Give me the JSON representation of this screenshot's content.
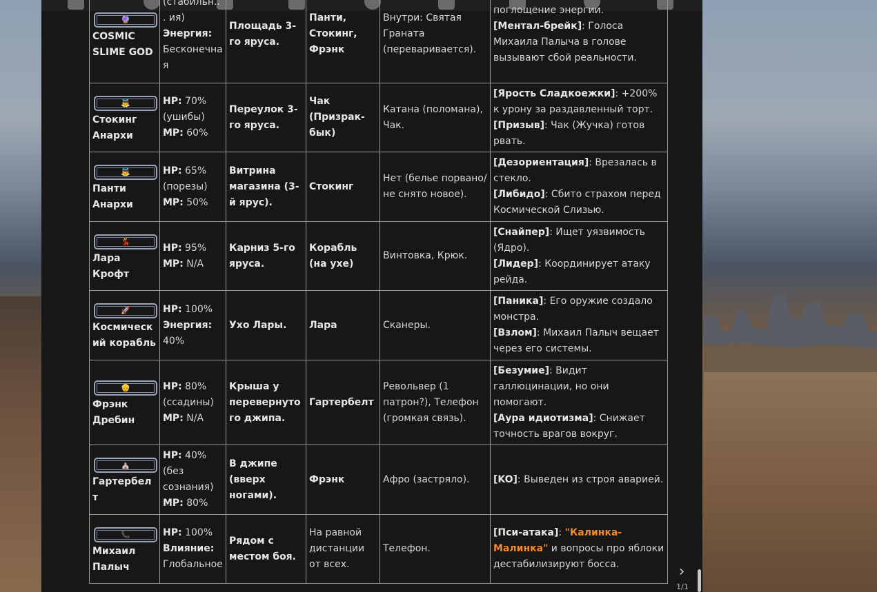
{
  "table": {
    "rows": [
      {
        "icon": "slime-icon",
        "emoji": "🔮",
        "name": "COSMIC SLIME GOD",
        "stats": [
          {
            "label": "",
            "value": "(стабильн... ия)"
          },
          {
            "label": "Энергия:",
            "value": "Бесконечная"
          }
        ],
        "location": "Площадь 3-го яруса.",
        "relation": "Панти, Стокинг, Фрэнк",
        "inventory": "Внутри: Святая Граната (переваривается).",
        "effects": [
          {
            "tag": "",
            "text": "поглощение энергии."
          },
          {
            "tag": "[Ментал-брейк]",
            "text": ": Голоса Михаила Палыча в голове вызывают сбой реальности."
          }
        ]
      },
      {
        "icon": "angel-icon",
        "emoji": "👼",
        "name": "Стокинг Анархи",
        "stats": [
          {
            "label": "HP:",
            "value": "70% (ушибы)"
          },
          {
            "label": "MP:",
            "value": "60%"
          }
        ],
        "location": "Переулок 3-го яруса.",
        "relation": "Чак (Призрак-бык)",
        "inventory": "Катана (поломана), Чак.",
        "effects": [
          {
            "tag": "[Ярость Сладкоежки]",
            "text": ": +200% к урону за раздавленный торт."
          },
          {
            "tag": "[Призыв]",
            "text": ": Чак (Жучка) готов рвать."
          }
        ]
      },
      {
        "icon": "angel-icon",
        "emoji": "👼",
        "name": "Панти Анархи",
        "stats": [
          {
            "label": "HP:",
            "value": "65% (порезы)"
          },
          {
            "label": "MP:",
            "value": "50%"
          }
        ],
        "location": "Витрина магазина (3-й ярус).",
        "relation": "Стокинг",
        "inventory": "Нет (белье порвано/не снято новое).",
        "effects": [
          {
            "tag": "[Дезориентация]",
            "text": ": Врезалась в стекло."
          },
          {
            "tag": "[Либидо]",
            "text": ": Сбито страхом перед Космической Слизью."
          }
        ]
      },
      {
        "icon": "dancer-icon",
        "emoji": "💃",
        "name": "Лара Крофт",
        "stats": [
          {
            "label": "HP:",
            "value": "95%"
          },
          {
            "label": "MP:",
            "value": "N/A"
          }
        ],
        "location": "Карниз 5-го яруса.",
        "relation": "Корабль (на ухе)",
        "inventory": "Винтовка, Крюк.",
        "effects": [
          {
            "tag": "[Снайпер]",
            "text": ": Ищет уязвимость (Ядро)."
          },
          {
            "tag": "[Лидер]",
            "text": ": Координирует атаку рейда."
          }
        ]
      },
      {
        "icon": "rocket-icon",
        "emoji": "🚀",
        "name": "Космический корабль",
        "stats": [
          {
            "label": "HP:",
            "value": "100%"
          },
          {
            "label": "Энергия:",
            "value": "40%"
          }
        ],
        "location": "Ухо Лары.",
        "relation": "Лара",
        "inventory": "Сканеры.",
        "effects": [
          {
            "tag": "[Паника]",
            "text": ": Его оружие создало монстра."
          },
          {
            "tag": "[Взлом]",
            "text": ": Михаил Палыч вещает через его системы."
          }
        ]
      },
      {
        "icon": "old-man-icon",
        "emoji": "👴",
        "name": "Фрэнк Дребин",
        "stats": [
          {
            "label": "HP:",
            "value": "80% (ссадины)"
          },
          {
            "label": "MP:",
            "value": "N/A"
          }
        ],
        "location": "Крыша у перевернутого джипа.",
        "relation": "Гартербелт",
        "inventory": "Револьвер (1 патрон?), Телефон (громкая связь).",
        "effects": [
          {
            "tag": "[Безумие]",
            "text": ": Видит галлюцинации, но они помогают."
          },
          {
            "tag": "[Аура идиотизма]",
            "text": ": Снижает точность врагов вокруг."
          }
        ]
      },
      {
        "icon": "church-icon",
        "emoji": "⛪",
        "name": "Гартербелт",
        "stats": [
          {
            "label": "HP:",
            "value": "40% (без сознания)"
          },
          {
            "label": "MP:",
            "value": "80%"
          }
        ],
        "location": "В джипе (вверх ногами).",
        "relation": "Фрэнк",
        "inventory": "Афро (застряло).",
        "effects": [
          {
            "tag": "[KO]",
            "text": ": Выведен из строя аварией."
          }
        ]
      },
      {
        "icon": "phone-icon",
        "emoji": "📞",
        "name": "Михаил Палыч",
        "stats": [
          {
            "label": "HP:",
            "value": "100%"
          },
          {
            "label": "Влияние:",
            "value": "Глобальное"
          }
        ],
        "location": "Рядом с местом боя.",
        "relation": "На равной дистанции от всех.",
        "inventory": "Телефон.",
        "effects": [
          {
            "tag": "[Пси-атака]",
            "text": ": ",
            "highlight": "\"Калинка-Малинка\"",
            "after": " и вопросы про яблоки дестабилизируют босса."
          }
        ]
      }
    ]
  },
  "pager": {
    "label": "1/1"
  },
  "nav": {
    "next_glyph": "›"
  },
  "colors": {
    "highlight": "#f08a2c",
    "panel": "#171717"
  }
}
